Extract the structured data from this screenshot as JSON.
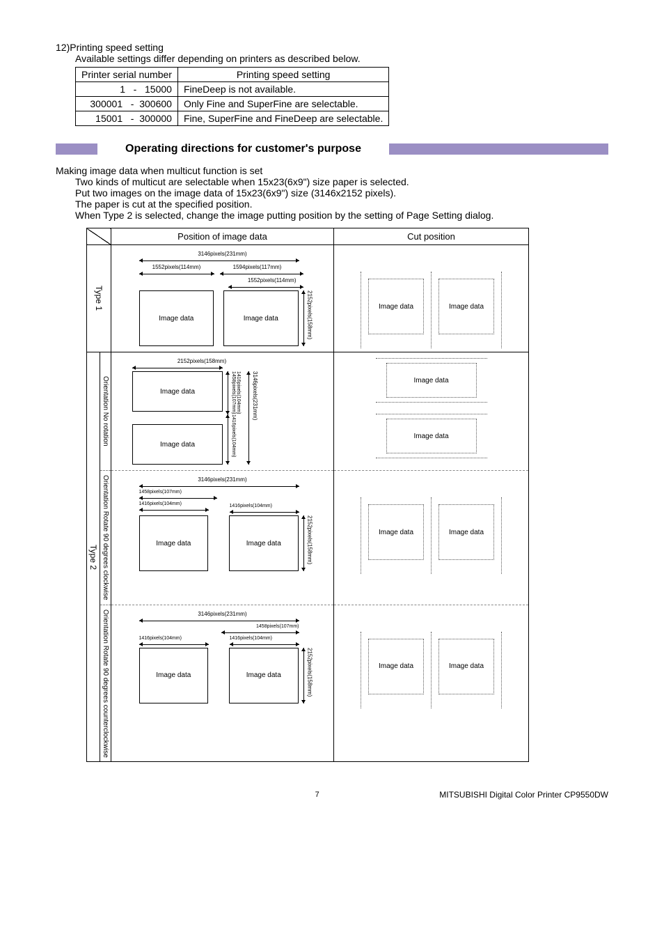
{
  "section": {
    "number": "12)",
    "title": "Printing speed setting",
    "subtitle": "Available settings differ depending on printers as described below."
  },
  "table": {
    "headers": {
      "serial": "Printer serial number",
      "setting": "Printing speed setting"
    },
    "rows": [
      {
        "range": "      1   -   15000",
        "setting": "FineDeep is not available."
      },
      {
        "range": "300001   -  300600",
        "setting": "Only Fine and SuperFine are selectable."
      },
      {
        "range": "  15001   -  300000",
        "setting": "Fine, SuperFine and FineDeep are selectable."
      }
    ]
  },
  "heading": "Operating directions for customer's purpose",
  "body": {
    "intro": "Making image data when multicut function is set",
    "lines": [
      "Two kinds of multicut are selectable when 15x23(6x9\") size paper is selected.",
      "Put two images on the image data of 15x23(6x9\") size (3146x2152 pixels).",
      "The paper is cut at the specified position.",
      "When Type 2 is selected, change the image putting position by the setting of Page Setting dialog."
    ]
  },
  "diagram": {
    "col_headers": {
      "pos": "Position of image data",
      "cut": "Cut position"
    },
    "type1": {
      "label": "Type 1"
    },
    "type2": {
      "label": "Type 2",
      "sub": {
        "norot": "Orientation\nNo rotation",
        "cw": "Orientation\nRotate 90 degrees clockwise",
        "ccw": "Orientation\nRotate 90 degrees counterclockwise"
      }
    },
    "dims": {
      "w3146": "3146pixels(231mm)",
      "w2152": "2152pixels(158mm)",
      "h2152": "2152pixels(158mm)",
      "h3146": "3146pixels(231mm)",
      "w1552": "1552pixels(114mm)",
      "w1594": "1594pixels(117mm)",
      "w1416": "1416pixels(104mm)",
      "w1458": "1458pixels(107mm)",
      "h1416": "1416pixels(104mm)",
      "h1458": "1458pixels(107mm)"
    },
    "img_label": "Image data"
  },
  "footer": {
    "page": "7",
    "model": "MITSUBISHI Digital Color Printer CP9550DW"
  }
}
